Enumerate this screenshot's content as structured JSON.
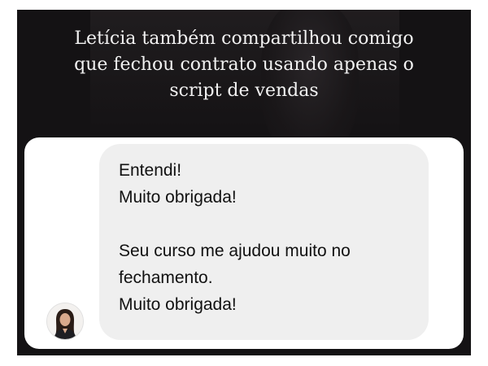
{
  "caption": {
    "line1": "Letícia também compartilhou comigo",
    "line2": "que fechou contrato usando apenas o",
    "line3": "script de vendas"
  },
  "message": {
    "line1": "Entendi!",
    "line2": "Muito obrigada!",
    "line3": "Seu curso me ajudou muito no",
    "line4": "fechamento.",
    "line5": "Muito obrigada!"
  },
  "avatar": {
    "icon": "user-avatar-photo"
  },
  "colors": {
    "background": "#141214",
    "bubble": "#efefef",
    "card": "#ffffff",
    "caption_text": "#f2f2f2"
  }
}
